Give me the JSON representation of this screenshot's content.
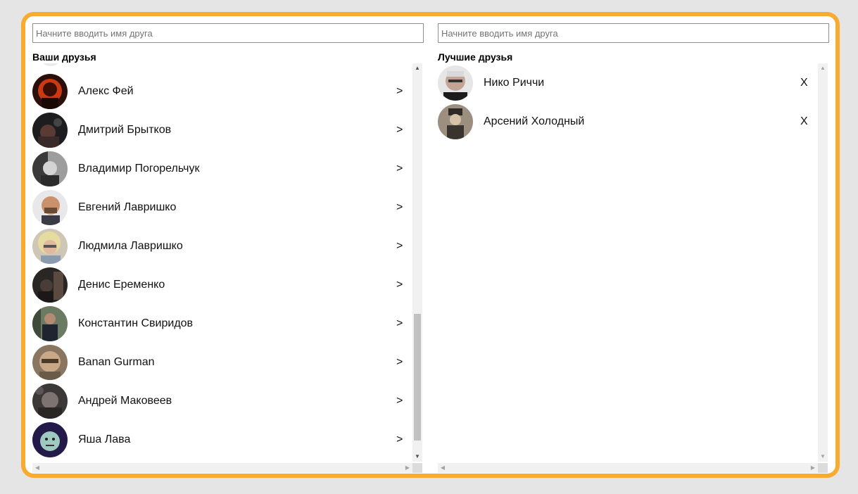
{
  "left_panel": {
    "search_placeholder": "Начните вводить имя друга",
    "heading": "Ваши друзья",
    "action_label": ">",
    "friends": [
      {
        "name": "Алекс Фей",
        "avatar": "dark-red-avatar"
      },
      {
        "name": "Дмитрий Брытков",
        "avatar": "dark-avatar"
      },
      {
        "name": "Владимир Погорельчук",
        "avatar": "grey-avatar"
      },
      {
        "name": "Евгений Лавришко",
        "avatar": "bald-man-avatar"
      },
      {
        "name": "Людмила Лавришко",
        "avatar": "blonde-woman-avatar"
      },
      {
        "name": "Денис Еременко",
        "avatar": "dark-room-avatar"
      },
      {
        "name": "Константин Свиридов",
        "avatar": "man-outdoor-avatar"
      },
      {
        "name": "Banan Gurman",
        "avatar": "man-glasses-avatar"
      },
      {
        "name": "Андрей Маковеев",
        "avatar": "dark-grey-avatar"
      },
      {
        "name": "Яша Лава",
        "avatar": "cartoon-avatar"
      }
    ]
  },
  "right_panel": {
    "search_placeholder": "Начните вводить имя друга",
    "heading": "Лучшие друзья",
    "action_label": "X",
    "friends": [
      {
        "name": "Нико Риччи",
        "avatar": "old-man-avatar"
      },
      {
        "name": "Арсений Холодный",
        "avatar": "sepia-man-avatar"
      }
    ]
  },
  "colors": {
    "frame_border": "#f8ab2e",
    "background": "#e5e5e5"
  }
}
